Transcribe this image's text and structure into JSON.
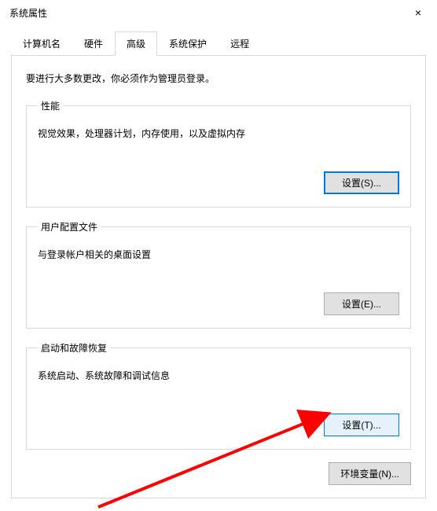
{
  "window": {
    "title": "系统属性",
    "close_label": "×"
  },
  "tabs": {
    "items": [
      {
        "label": "计算机名"
      },
      {
        "label": "硬件"
      },
      {
        "label": "高级"
      },
      {
        "label": "系统保护"
      },
      {
        "label": "远程"
      }
    ]
  },
  "content": {
    "intro": "要进行大多数更改，你必须作为管理员登录。",
    "performance": {
      "legend": "性能",
      "desc": "视觉效果，处理器计划，内存使用，以及虚拟内存",
      "button": "设置(S)..."
    },
    "profiles": {
      "legend": "用户配置文件",
      "desc": "与登录帐户相关的桌面设置",
      "button": "设置(E)..."
    },
    "startup": {
      "legend": "启动和故障恢复",
      "desc": "系统启动、系统故障和调试信息",
      "button": "设置(T)..."
    },
    "env_button": "环境变量(N)..."
  }
}
